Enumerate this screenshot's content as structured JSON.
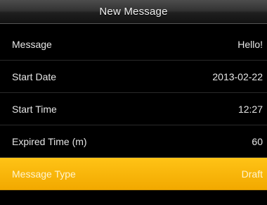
{
  "header": {
    "title": "New Message"
  },
  "rows": [
    {
      "label": "Message",
      "value": "Hello!"
    },
    {
      "label": "Start Date",
      "value": "2013-02-22"
    },
    {
      "label": "Start Time",
      "value": "12:27"
    },
    {
      "label": "Expired Time (m)",
      "value": "60"
    },
    {
      "label": "Message Type",
      "value": "Draft"
    }
  ],
  "selected_row": "Message Type",
  "colors": {
    "background": "#000000",
    "selected_row": "#f5b400",
    "text": "#e6e6e6"
  }
}
